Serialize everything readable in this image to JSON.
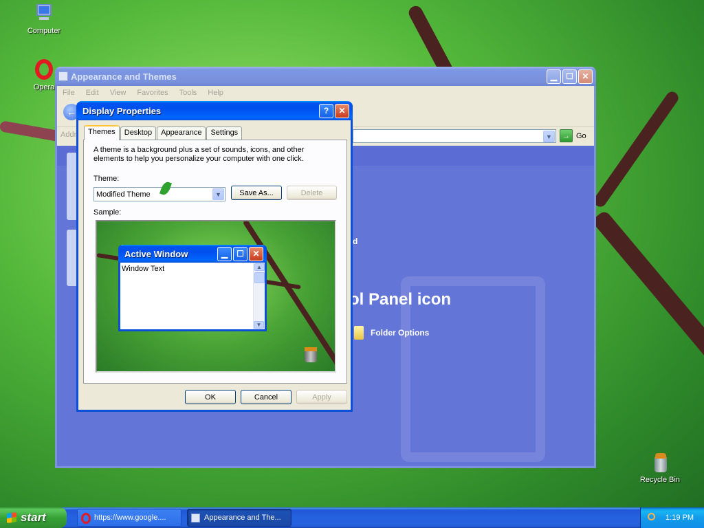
{
  "desktop": {
    "icons": [
      {
        "label": "Computer"
      },
      {
        "label": "Opera"
      },
      {
        "label": "Recycle Bin"
      }
    ]
  },
  "control_panel": {
    "title": "Appearance and Themes",
    "menu": [
      "File",
      "Edit",
      "View",
      "Favorites",
      "Tools",
      "Help"
    ],
    "address_label": "Addr",
    "go_label": "Go",
    "big_text": "ol Panel icon",
    "partial_text": "d",
    "folder_options_label": "Folder Options"
  },
  "dialog": {
    "title": "Display Properties",
    "help_icon": "?",
    "close_icon": "✕",
    "tabs": [
      "Themes",
      "Desktop",
      "Appearance",
      "Settings"
    ],
    "description": "A theme is a background plus a set of sounds, icons, and other elements to help you personalize your computer with one click.",
    "theme_label": "Theme:",
    "theme_value": "Modified Theme",
    "save_as_label": "Save As...",
    "delete_label": "Delete",
    "sample_label": "Sample:",
    "sample_window": {
      "title": "Active Window",
      "text": "Window Text"
    },
    "ok_label": "OK",
    "cancel_label": "Cancel",
    "apply_label": "Apply"
  },
  "taskbar": {
    "start_label": "start",
    "tasks": [
      {
        "label": "https://www.google...."
      },
      {
        "label": "Appearance and The..."
      }
    ],
    "clock": "1:19 PM"
  },
  "colors": {
    "xp_blue": "#0053ee",
    "cp_body": "#6375d6",
    "start_green": "#37a337"
  }
}
